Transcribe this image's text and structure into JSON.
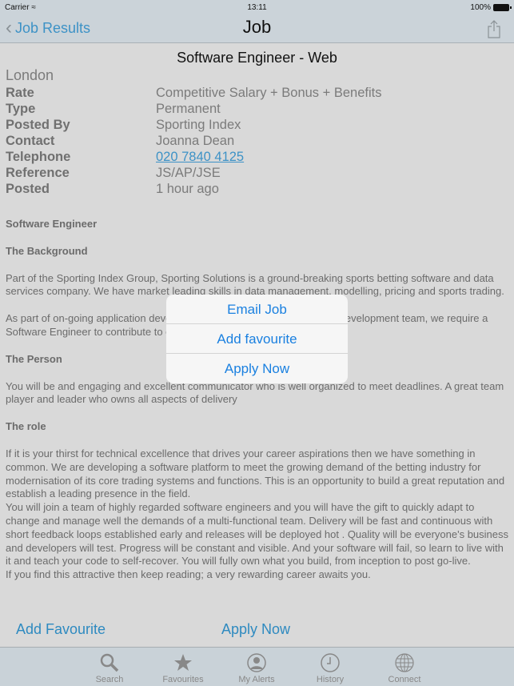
{
  "status_bar": {
    "carrier": "Carrier",
    "time": "13:11",
    "battery": "100%"
  },
  "nav": {
    "back_label": "Job Results",
    "title": "Job"
  },
  "job": {
    "title": "Software Engineer - Web",
    "location": "London",
    "fields": [
      {
        "label": "Rate",
        "value": "Competitive Salary + Bonus + Benefits"
      },
      {
        "label": "Type",
        "value": "Permanent"
      },
      {
        "label": "Posted By",
        "value": "Sporting Index"
      },
      {
        "label": "Contact",
        "value": "Joanna Dean"
      },
      {
        "label": "Telephone",
        "value": "020 7840 4125"
      },
      {
        "label": "Reference",
        "value": "JS/AP/JSE"
      },
      {
        "label": "Posted",
        "value": "1 hour ago"
      }
    ]
  },
  "description": {
    "h1": "Software Engineer",
    "h2": "The Background",
    "p1": "Part of the Sporting Index Group, Sporting Solutions is a ground-breaking sports betting software and data services company. We have market leading skills in data management, modelling, pricing and sports trading.",
    "p2": "As part of on-going application development within our Trading Platform Development team, we require a Software Engineer to contribute to our core range of products.",
    "h3": "The Person",
    "p3": "You will be and engaging and excellent communicator who is well organized to meet deadlines. A great team player and leader who owns all aspects of delivery",
    "h4": "The role",
    "p4": "If it is your thirst for technical excellence that drives your career aspirations then we have something in common. We are developing a software platform to meet the growing demand of the betting industry for modernisation of its core trading systems and functions. This is an opportunity to build a great reputation and establish a leading presence in the field.",
    "p5": "You will join a team of highly regarded software engineers and you will have the gift to quickly adapt to change and manage well the demands of a multi-functional team. Delivery will be fast and continuous with short feedback loops established early and releases will be deployed hot . Quality will be everyone's business and developers will test. Progress will be constant and visible. And your software will fail, so learn to live with it and teach your code to self-recover. You will fully own what you build, from inception to post go-live.",
    "p6": "If you find this attractive then keep reading; a very rewarding career awaits you."
  },
  "actions": {
    "add_favourite": "Add Favourite",
    "apply_now": "Apply Now"
  },
  "popup": {
    "items": [
      "Email Job",
      "Add favourite",
      "Apply Now"
    ]
  },
  "tabbar": {
    "items": [
      {
        "label": "Search",
        "icon": "search-icon"
      },
      {
        "label": "Favourites",
        "icon": "star-icon"
      },
      {
        "label": "My Alerts",
        "icon": "user-icon"
      },
      {
        "label": "History",
        "icon": "clock-icon"
      },
      {
        "label": "Connect",
        "icon": "globe-icon"
      }
    ]
  },
  "colors": {
    "accent": "#3d92c6",
    "popup_text": "#1a80e0",
    "bar_bg": "#cbd3d9"
  }
}
